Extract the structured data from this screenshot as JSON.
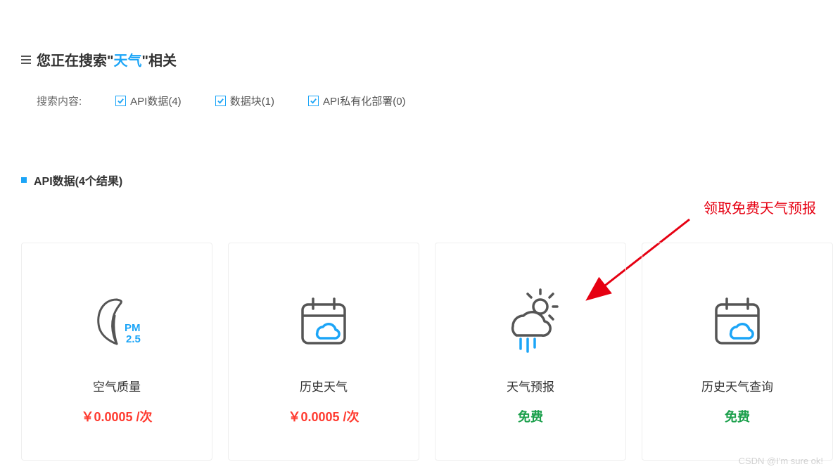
{
  "header": {
    "prefix": "您正在搜索\"",
    "keyword": "天气",
    "suffix": "\"相关"
  },
  "filters": {
    "label": "搜索内容:",
    "items": [
      {
        "label": "API数据(4)",
        "checked": true
      },
      {
        "label": "数据块(1)",
        "checked": true
      },
      {
        "label": "API私有化部署(0)",
        "checked": true
      }
    ]
  },
  "section": {
    "title": "API数据(4个结果)"
  },
  "annotation": "领取免费天气预报",
  "cards": [
    {
      "title": "空气质量",
      "price": "￥0.0005 /次",
      "free": false,
      "icon": "leaf-pm25"
    },
    {
      "title": "历史天气",
      "price": "￥0.0005 /次",
      "free": false,
      "icon": "calendar-cloud"
    },
    {
      "title": "天气预报",
      "price": "免费",
      "free": true,
      "icon": "sun-cloud-rain"
    },
    {
      "title": "历史天气查询",
      "price": "免费",
      "free": true,
      "icon": "calendar-cloud"
    }
  ],
  "watermark": "CSDN @I'm sure ok!"
}
